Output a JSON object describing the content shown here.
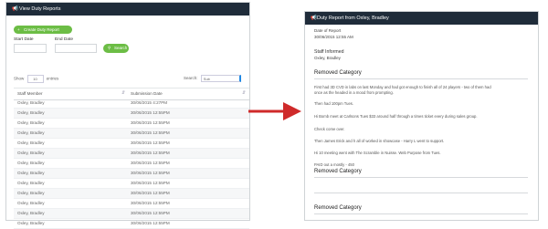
{
  "left": {
    "header_title": "View Duty Reports",
    "create_button": "Create Duty Report",
    "start_date_label": "Start Date",
    "end_date_label": "End Date",
    "search_button": "Search",
    "show_label": "Show",
    "show_value": "10",
    "entries_label": "entries",
    "search_label": "Search:",
    "search_value": "Sub",
    "columns": [
      "Staff Member",
      "Submission Date"
    ],
    "rows": [
      [
        "Oxley, Bradley",
        "30/06/2015 4:27PM"
      ],
      [
        "Oxley, Bradley",
        "30/06/2015 12:55PM"
      ],
      [
        "Oxley, Bradley",
        "30/06/2015 12:55PM"
      ],
      [
        "Oxley, Bradley",
        "30/06/2015 12:55PM"
      ],
      [
        "Oxley, Bradley",
        "30/06/2015 12:55PM"
      ],
      [
        "Oxley, Bradley",
        "30/06/2015 12:55PM"
      ],
      [
        "Oxley, Bradley",
        "30/06/2015 12:55PM"
      ],
      [
        "Oxley, Bradley",
        "30/06/2015 12:55PM"
      ],
      [
        "Oxley, Bradley",
        "30/06/2015 12:55PM"
      ],
      [
        "Oxley, Bradley",
        "30/06/2015 12:55PM"
      ],
      [
        "Oxley, Bradley",
        "30/06/2015 12:55PM"
      ],
      [
        "Oxley, Bradley",
        "30/06/2015 12:55PM"
      ],
      [
        "Oxley, Bradley",
        "30/06/2015 12:55PM"
      ]
    ]
  },
  "right": {
    "header_title": "Duty Report from Oxley, Bradley",
    "created_label": "Date of Report",
    "created_value": "30/06/2015 12:55 AM",
    "staff_label": "Staff Informed",
    "staff_value": "Oxley, Bradley",
    "section1_title": "Removed Category",
    "body_lines": [
      "First had 3D CVD in labs on last Monday and had got enough to finish all of 24 players - two of them had",
      "once as the headed in a mood from prompting.",
      "Then had 100pm Tues.",
      "Hi Bomb meet at Carlsons Tues $33 around half through a times ticket every during sales group.",
      "Check come over.",
      "Then James Erick and h all of worked in showcase - Harry L went to support.",
      "Hi 10 meeting went with The Scramble in Nuisse. Web Purpose from Tues.",
      "PAID out a mostly - 450"
    ],
    "section2_title": "Removed Category",
    "section3_title": "Removed Category"
  },
  "colors": {
    "header_bg": "#1f2c3a",
    "green": "#6cbd45",
    "arrow": "#cf2a2a"
  }
}
